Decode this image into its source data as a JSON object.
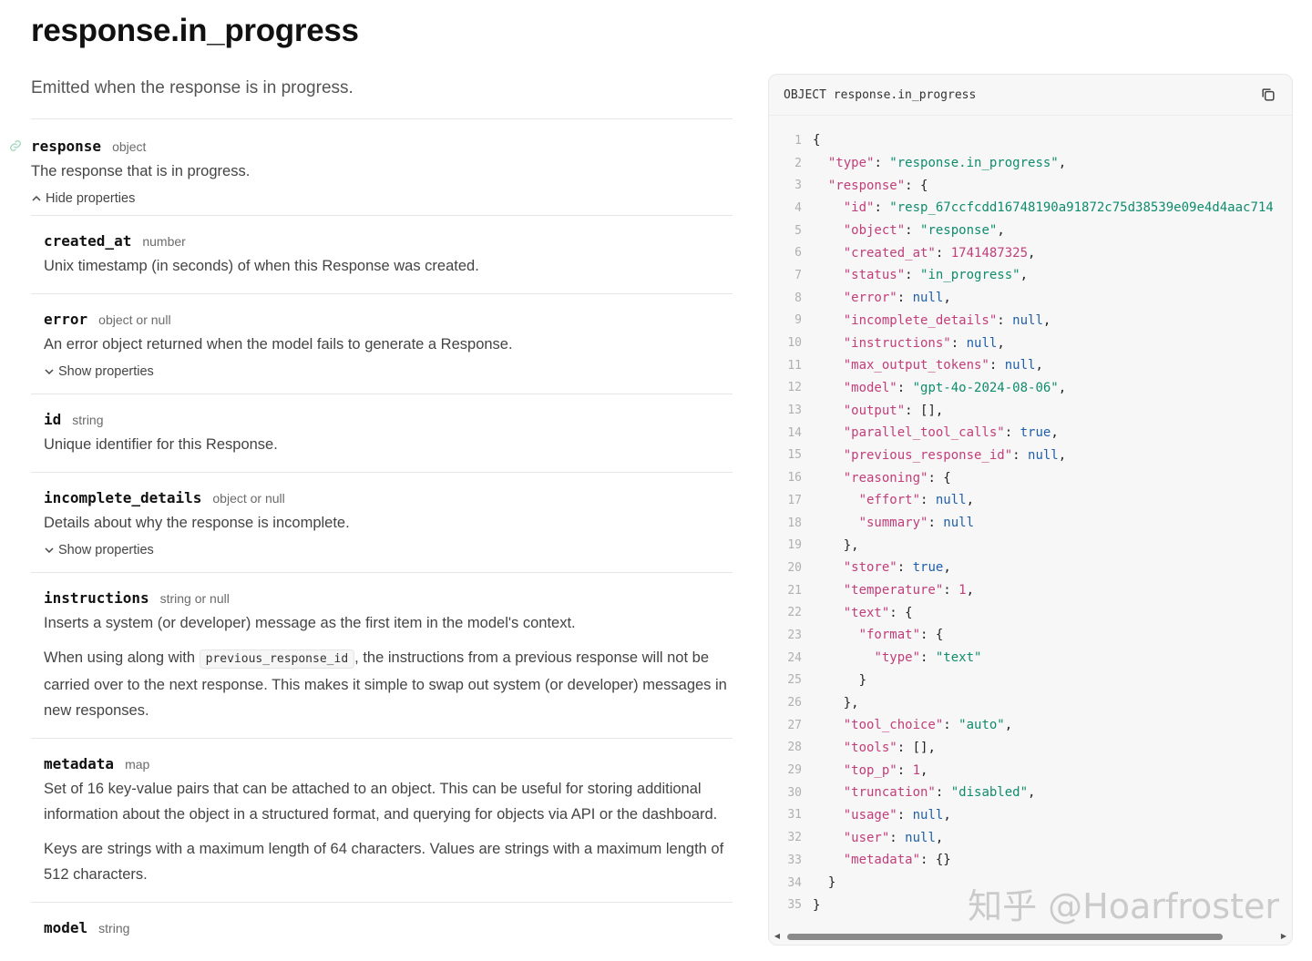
{
  "page": {
    "title": "response.in_progress",
    "description": "Emitted when the response is in progress."
  },
  "response_param": {
    "name": "response",
    "type": "object",
    "description": "The response that is in progress.",
    "toggle": "Hide properties"
  },
  "properties": [
    {
      "name": "created_at",
      "type": "number",
      "desc": [
        "Unix timestamp (in seconds) of when this Response was created."
      ],
      "toggle": ""
    },
    {
      "name": "error",
      "type": "object or null",
      "desc": [
        "An error object returned when the model fails to generate a Response."
      ],
      "toggle": "Show properties"
    },
    {
      "name": "id",
      "type": "string",
      "desc": [
        "Unique identifier for this Response."
      ],
      "toggle": ""
    },
    {
      "name": "incomplete_details",
      "type": "object or null",
      "desc": [
        "Details about why the response is incomplete."
      ],
      "toggle": "Show properties"
    },
    {
      "name": "instructions",
      "type": "string or null",
      "desc": [
        "Inserts a system (or developer) message as the first item in the model's context."
      ],
      "toggle": ""
    },
    {
      "name": "metadata",
      "type": "map",
      "desc": [
        "Set of 16 key-value pairs that can be attached to an object. This can be useful for storing additional information about the object in a structured format, and querying for objects via API or the dashboard.",
        "Keys are strings with a maximum length of 64 characters. Values are strings with a maximum length of 512 characters."
      ],
      "toggle": ""
    },
    {
      "name": "model",
      "type": "string",
      "desc": [],
      "toggle": ""
    }
  ],
  "instructions_note": {
    "before": "When using along with ",
    "code": "previous_response_id",
    "after": ", the instructions from a previous response will not be carried over to the next response. This makes it simple to swap out system (or developer) messages in new responses."
  },
  "code_panel": {
    "title": "OBJECT response.in_progress",
    "lines": [
      "{",
      "  \"type\": \"response.in_progress\",",
      "  \"response\": {",
      "    \"id\": \"resp_67ccfcdd16748190a91872c75d38539e09e4d4aac714",
      "    \"object\": \"response\",",
      "    \"created_at\": 1741487325,",
      "    \"status\": \"in_progress\",",
      "    \"error\": null,",
      "    \"incomplete_details\": null,",
      "    \"instructions\": null,",
      "    \"max_output_tokens\": null,",
      "    \"model\": \"gpt-4o-2024-08-06\",",
      "    \"output\": [],",
      "    \"parallel_tool_calls\": true,",
      "    \"previous_response_id\": null,",
      "    \"reasoning\": {",
      "      \"effort\": null,",
      "      \"summary\": null",
      "    },",
      "    \"store\": true,",
      "    \"temperature\": 1,",
      "    \"text\": {",
      "      \"format\": {",
      "        \"type\": \"text\"",
      "      }",
      "    },",
      "    \"tool_choice\": \"auto\",",
      "    \"tools\": [],",
      "    \"top_p\": 1,",
      "    \"truncation\": \"disabled\",",
      "    \"usage\": null,",
      "    \"user\": null,",
      "    \"metadata\": {}",
      "  }",
      "}"
    ]
  },
  "watermark": "知乎 @Hoarfroster",
  "colors": {
    "key": "#c13e7a",
    "string": "#0f8c6b",
    "literal": "#1f5fa8",
    "link_icon": "#9bd3b8"
  }
}
